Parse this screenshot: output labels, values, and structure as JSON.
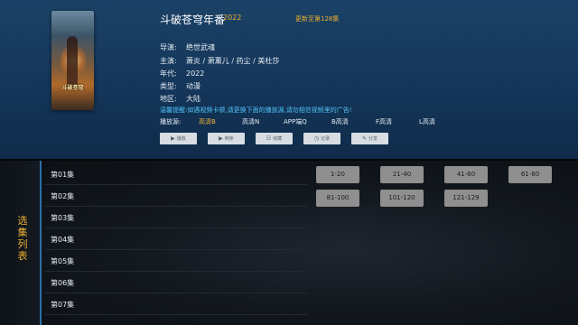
{
  "show": {
    "title": "斗破苍穹年番",
    "year": "2022",
    "update_status": "更新至第128集",
    "poster_text": "斗破苍穹"
  },
  "meta": [
    {
      "key": "导演:",
      "value": "绝世武魂"
    },
    {
      "key": "主演:",
      "value": "萧炎 / 萧薰儿 / 药尘 / 美杜莎"
    },
    {
      "key": "年代:",
      "value": "2022"
    },
    {
      "key": "类型:",
      "value": "动漫"
    },
    {
      "key": "地区:",
      "value": "大陆"
    }
  ],
  "notice": "温馨提醒:如遇视频卡顿,请更换下面的播放源,请勿相信视频里的广告!",
  "sources": {
    "label": "播放源:",
    "items": [
      "高清B",
      "高清N",
      "APP端Q",
      "B高清",
      "F高清",
      "L高清"
    ],
    "active": 0
  },
  "actions": [
    {
      "label": "播放",
      "icon": "play-icon"
    },
    {
      "label": "倒序",
      "icon": "play-icon"
    },
    {
      "label": "收藏",
      "icon": "list-icon"
    },
    {
      "label": "记录",
      "icon": "clock-icon"
    },
    {
      "label": "分享",
      "icon": "edit-icon"
    }
  ],
  "sidebar": {
    "label": "选集列表"
  },
  "episodes": [
    "第01集",
    "第02集",
    "第03集",
    "第04集",
    "第05集",
    "第06集",
    "第07集"
  ],
  "ranges": [
    "1-20",
    "21-40",
    "41-60",
    "61-80",
    "81-100",
    "101-120",
    "121-129"
  ],
  "colors": {
    "accent": "#f0b030",
    "notice": "#4fc3f7",
    "header_bg": "#14365a",
    "range_button": "#8f8f8f"
  }
}
